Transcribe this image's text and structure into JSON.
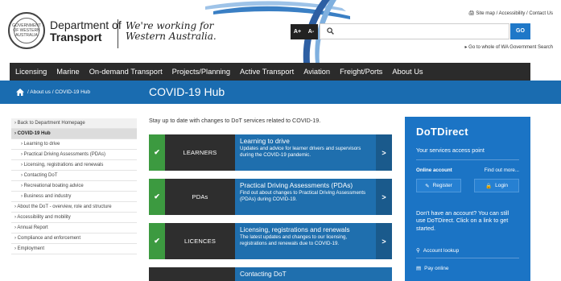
{
  "header": {
    "dept_line1": "Department of",
    "dept_line2": "Transport",
    "crest_text": "GOVERNMENT OF WESTERN AUSTRALIA",
    "tagline_line1": "We're working for",
    "tagline_line2": "Western Australia.",
    "util_links": "Site map / Accessibility / Contact Us",
    "font_larger": "A+",
    "font_smaller": "A-",
    "search_placeholder": "",
    "go_label": "GO",
    "wa_link": "Go to whole of WA Government Search"
  },
  "nav": {
    "items": [
      "Licensing",
      "Marine",
      "On-demand Transport",
      "Projects/Planning",
      "Active Transport",
      "Aviation",
      "Freight/Ports",
      "About Us"
    ]
  },
  "banner": {
    "breadcrumb": "/ About us / COVID-19 Hub",
    "title": "COVID-19 Hub"
  },
  "sidebar": {
    "items": [
      {
        "label": "Back to Department Homepage",
        "kind": "back"
      },
      {
        "label": "COVID-19 Hub",
        "kind": "active"
      },
      {
        "label": "Learning to drive",
        "kind": "sub"
      },
      {
        "label": "Practical Driving Assessments (PDAs)",
        "kind": "sub"
      },
      {
        "label": "Licensing, registrations and renewals",
        "kind": "sub"
      },
      {
        "label": "Contacting DoT",
        "kind": "sub"
      },
      {
        "label": "Recreational boating advice",
        "kind": "sub"
      },
      {
        "label": "Business and industry",
        "kind": "sub"
      },
      {
        "label": "About the DoT - overview, role and structure",
        "kind": "top"
      },
      {
        "label": "Accessibility and mobility",
        "kind": "top"
      },
      {
        "label": "Annual Report",
        "kind": "top"
      },
      {
        "label": "Compliance and enforcement",
        "kind": "top"
      },
      {
        "label": "Employment",
        "kind": "top"
      }
    ]
  },
  "main": {
    "intro": "Stay up to date with changes to DoT services related to COVID-19.",
    "cards": [
      {
        "label": "LEARNERS",
        "title": "Learning to drive",
        "desc": "Updates and advice for learner drivers and supervisors during the COVID-19 pandemic."
      },
      {
        "label": "PDAs",
        "title": "Practical Driving Assessments (PDAs)",
        "desc": "Find out about changes to Practical Driving Assessments (PDAs) during COVID-19."
      },
      {
        "label": "LICENCES",
        "title": "Licensing, registrations and renewals",
        "desc": "The latest updates and changes to our licensing, registrations and renewals due to COVID-19."
      },
      {
        "label": "",
        "title": "Contacting DoT",
        "desc": ""
      }
    ]
  },
  "dotdirect": {
    "brand": "DoTDirect",
    "sub": "Your services access point",
    "online_account": "Online account",
    "find_out_more": "Find out more...",
    "register": "Register",
    "login": "Login",
    "no_account": "Don't have an account? You can still use DoTDirect. Click on a link to get started.",
    "account_lookup": "Account lookup",
    "pay_online": "Pay online"
  },
  "colors": {
    "nav_bg": "#2b2b2b",
    "banner_bg": "#1a6cb0",
    "dot_bg": "#1b74c5",
    "tick_green": "#3c9a40",
    "card_blue": "#1f6fae"
  }
}
